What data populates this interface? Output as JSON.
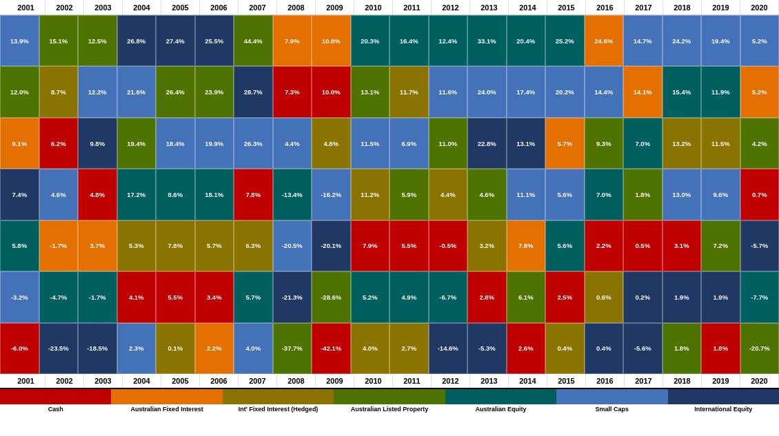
{
  "years": [
    "2001",
    "2002",
    "2003",
    "2004",
    "2005",
    "2006",
    "2007",
    "2008",
    "2009",
    "2010",
    "2011",
    "2012",
    "2013",
    "2014",
    "2015",
    "2016",
    "2017",
    "2018",
    "2019",
    "2020"
  ],
  "rows": [
    {
      "values": [
        "13.9%",
        "15.1%",
        "12.5%",
        "26.8%",
        "27.4%",
        "25.5%",
        "44.4%",
        "7.9%",
        "10.8%",
        "20.3%",
        "16.4%",
        "12.4%",
        "33.1%",
        "20.4%",
        "25.2%",
        "24.6%",
        "14.7%",
        "24.2%",
        "19.4%",
        "5.2%"
      ],
      "colors": [
        "sc",
        "alp",
        "alp",
        "ie",
        "ie",
        "ie",
        "alp",
        "afi",
        "afi",
        "ae",
        "ae",
        "ae",
        "ae",
        "ae",
        "ae",
        "afi",
        "sc",
        "sc",
        "sc",
        "sc"
      ]
    },
    {
      "values": [
        "12.0%",
        "8.7%",
        "12.2%",
        "21.6%",
        "26.4%",
        "23.9%",
        "28.7%",
        "7.3%",
        "10.0%",
        "13.1%",
        "11.7%",
        "11.6%",
        "24.0%",
        "17.4%",
        "20.2%",
        "14.4%",
        "14.1%",
        "15.4%",
        "11.9%",
        "5.2%"
      ],
      "colors": [
        "alp",
        "ifi",
        "sc",
        "sc",
        "alp",
        "alp",
        "ie",
        "cash",
        "cash",
        "alp",
        "ifi",
        "sc",
        "sc",
        "sc",
        "sc",
        "sc",
        "afi",
        "ae",
        "ae",
        "afi"
      ]
    },
    {
      "values": [
        "9.1%",
        "6.2%",
        "9.8%",
        "19.4%",
        "18.4%",
        "19.9%",
        "26.3%",
        "4.4%",
        "4.8%",
        "11.5%",
        "6.9%",
        "11.0%",
        "22.8%",
        "13.1%",
        "5.7%",
        "9.3%",
        "7.0%",
        "13.2%",
        "11.5%",
        "4.2%"
      ],
      "colors": [
        "afi",
        "cash",
        "ie",
        "alp",
        "sc",
        "sc",
        "sc",
        "sc",
        "ifi",
        "sc",
        "sc",
        "alp",
        "ie",
        "ie",
        "afi",
        "alp",
        "ae",
        "ifi",
        "ifi",
        "alp"
      ]
    },
    {
      "values": [
        "7.4%",
        "4.6%",
        "4.8%",
        "17.2%",
        "8.6%",
        "18.1%",
        "7.8%",
        "-13.4%",
        "-16.2%",
        "11.2%",
        "5.9%",
        "4.4%",
        "4.6%",
        "11.1%",
        "5.6%",
        "7.0%",
        "1.8%",
        "13.0%",
        "9.6%",
        "0.7%"
      ],
      "colors": [
        "ie",
        "sc",
        "cash",
        "ae",
        "ae",
        "ae",
        "cash",
        "ae",
        "sc",
        "ifi",
        "alp",
        "ifi",
        "alp",
        "sc",
        "sc",
        "ae",
        "alp",
        "sc",
        "sc",
        "cash"
      ]
    },
    {
      "values": [
        "5.8%",
        "-1.7%",
        "3.7%",
        "5.3%",
        "7.8%",
        "5.7%",
        "6.3%",
        "-20.5%",
        "-20.1%",
        "7.9%",
        "5.5%",
        "-0.5%",
        "3.2%",
        "7.8%",
        "5.6%",
        "2.2%",
        "0.5%",
        "3.1%",
        "7.2%",
        "-5.7%"
      ],
      "colors": [
        "ae",
        "afi",
        "afi",
        "ifi",
        "ifi",
        "ifi",
        "ifi",
        "sc",
        "ie",
        "cash",
        "cash",
        "cash",
        "ifi",
        "afi",
        "ae",
        "cash",
        "cash",
        "cash",
        "alp",
        "ie"
      ]
    },
    {
      "values": [
        "-3.2%",
        "-4.7%",
        "-1.7%",
        "4.1%",
        "5.5%",
        "3.4%",
        "5.7%",
        "-21.3%",
        "-28.6%",
        "5.2%",
        "4.9%",
        "-6.7%",
        "2.8%",
        "6.1%",
        "2.5%",
        "0.6%",
        "0.2%",
        "1.9%",
        "1.9%",
        "-7.7%"
      ],
      "colors": [
        "sc",
        "ae",
        "ae",
        "cash",
        "cash",
        "cash",
        "ae",
        "ie",
        "alp",
        "ae",
        "ae",
        "ae",
        "cash",
        "alp",
        "cash",
        "ifi",
        "ie",
        "ie",
        "ie",
        "ae"
      ]
    },
    {
      "values": [
        "-6.0%",
        "-23.5%",
        "-18.5%",
        "2.3%",
        "0.1%",
        "2.2%",
        "4.0%",
        "-37.7%",
        "-42.1%",
        "4.0%",
        "2.7%",
        "-14.6%",
        "-5.3%",
        "2.6%",
        "0.4%",
        "0.4%",
        "-5.6%",
        "1.8%",
        "1.8%",
        "-20.7%"
      ],
      "colors": [
        "cash",
        "ie",
        "ie",
        "sc",
        "ifi",
        "afi",
        "sc",
        "alp",
        "cash",
        "ifi",
        "ifi",
        "ie",
        "ie",
        "cash",
        "ifi",
        "ie",
        "ie",
        "alp",
        "cash",
        "alp"
      ]
    }
  ],
  "legend": [
    {
      "label": "Cash",
      "colorClass": "cash"
    },
    {
      "label": "Australian Fixed Interest",
      "colorClass": "afi"
    },
    {
      "label": "Int' Fixed Interest (Hedged)",
      "colorClass": "ifi"
    },
    {
      "label": "Australian Listed Property",
      "colorClass": "alp"
    },
    {
      "label": "Australian Equity",
      "colorClass": "ae"
    },
    {
      "label": "Small Caps",
      "colorClass": "sc"
    },
    {
      "label": "International Equity",
      "colorClass": "ie"
    }
  ]
}
